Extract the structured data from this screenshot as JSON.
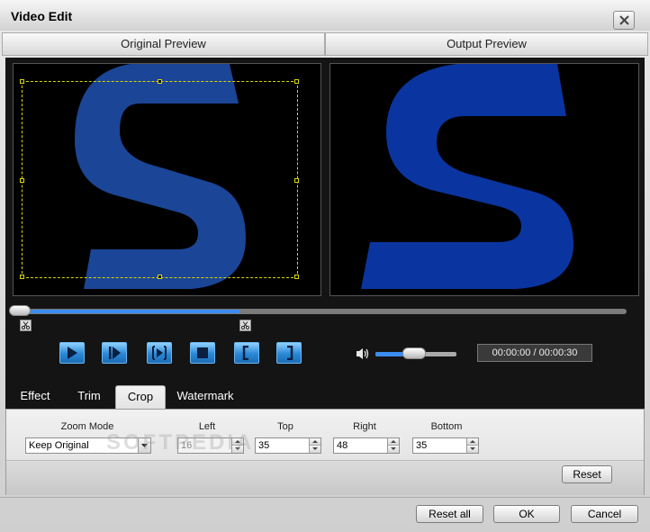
{
  "window": {
    "title": "Video Edit"
  },
  "preview": {
    "original_label": "Original Preview",
    "output_label": "Output Preview"
  },
  "playback": {
    "time_display": "00:00:00 / 00:00:30"
  },
  "tabs": [
    {
      "label": "Effect"
    },
    {
      "label": "Trim"
    },
    {
      "label": "Crop",
      "active": true
    },
    {
      "label": "Watermark"
    }
  ],
  "crop": {
    "zoom_mode": {
      "label": "Zoom Mode",
      "value": "Keep Original"
    },
    "left": {
      "label": "Left",
      "value": "16"
    },
    "top": {
      "label": "Top",
      "value": "35"
    },
    "right": {
      "label": "Right",
      "value": "48"
    },
    "bottom": {
      "label": "Bottom",
      "value": "35"
    },
    "reset_label": "Reset"
  },
  "footer": {
    "reset_all_label": "Reset all",
    "ok_label": "OK",
    "cancel_label": "Cancel"
  },
  "watermark": "SOFTPEDIA",
  "colors": {
    "accent": "#3a8cf0",
    "logo_blue": "#1a4aa8",
    "crop_guide": "#d8d800"
  }
}
